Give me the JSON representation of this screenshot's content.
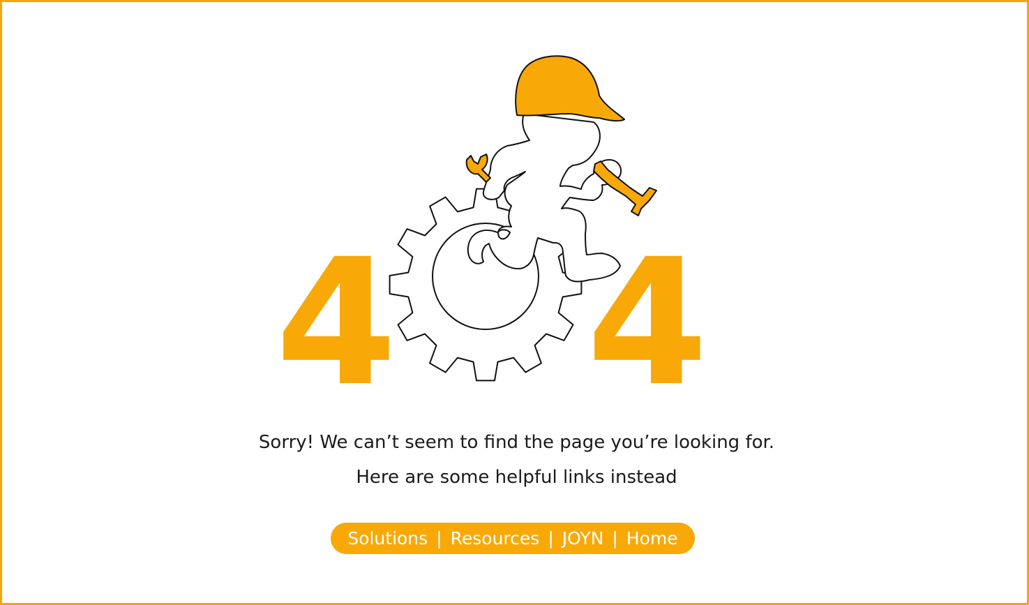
{
  "error_code": {
    "first_digit": "4",
    "last_digit": "4"
  },
  "illustration": {
    "icon": "mechanic-running-on-gear-icon",
    "accent_color": "#f8a908"
  },
  "messages": {
    "line1": "Sorry! We can’t seem to find the page you’re looking for.",
    "line2": "Here are some helpful links instead"
  },
  "links": {
    "items": [
      "Solutions",
      "Resources",
      "JOYN",
      "Home"
    ],
    "separator": "|",
    "background_color": "#f8a908",
    "text_color": "#ffffff"
  },
  "frame": {
    "border_color": "#f5a60a"
  }
}
